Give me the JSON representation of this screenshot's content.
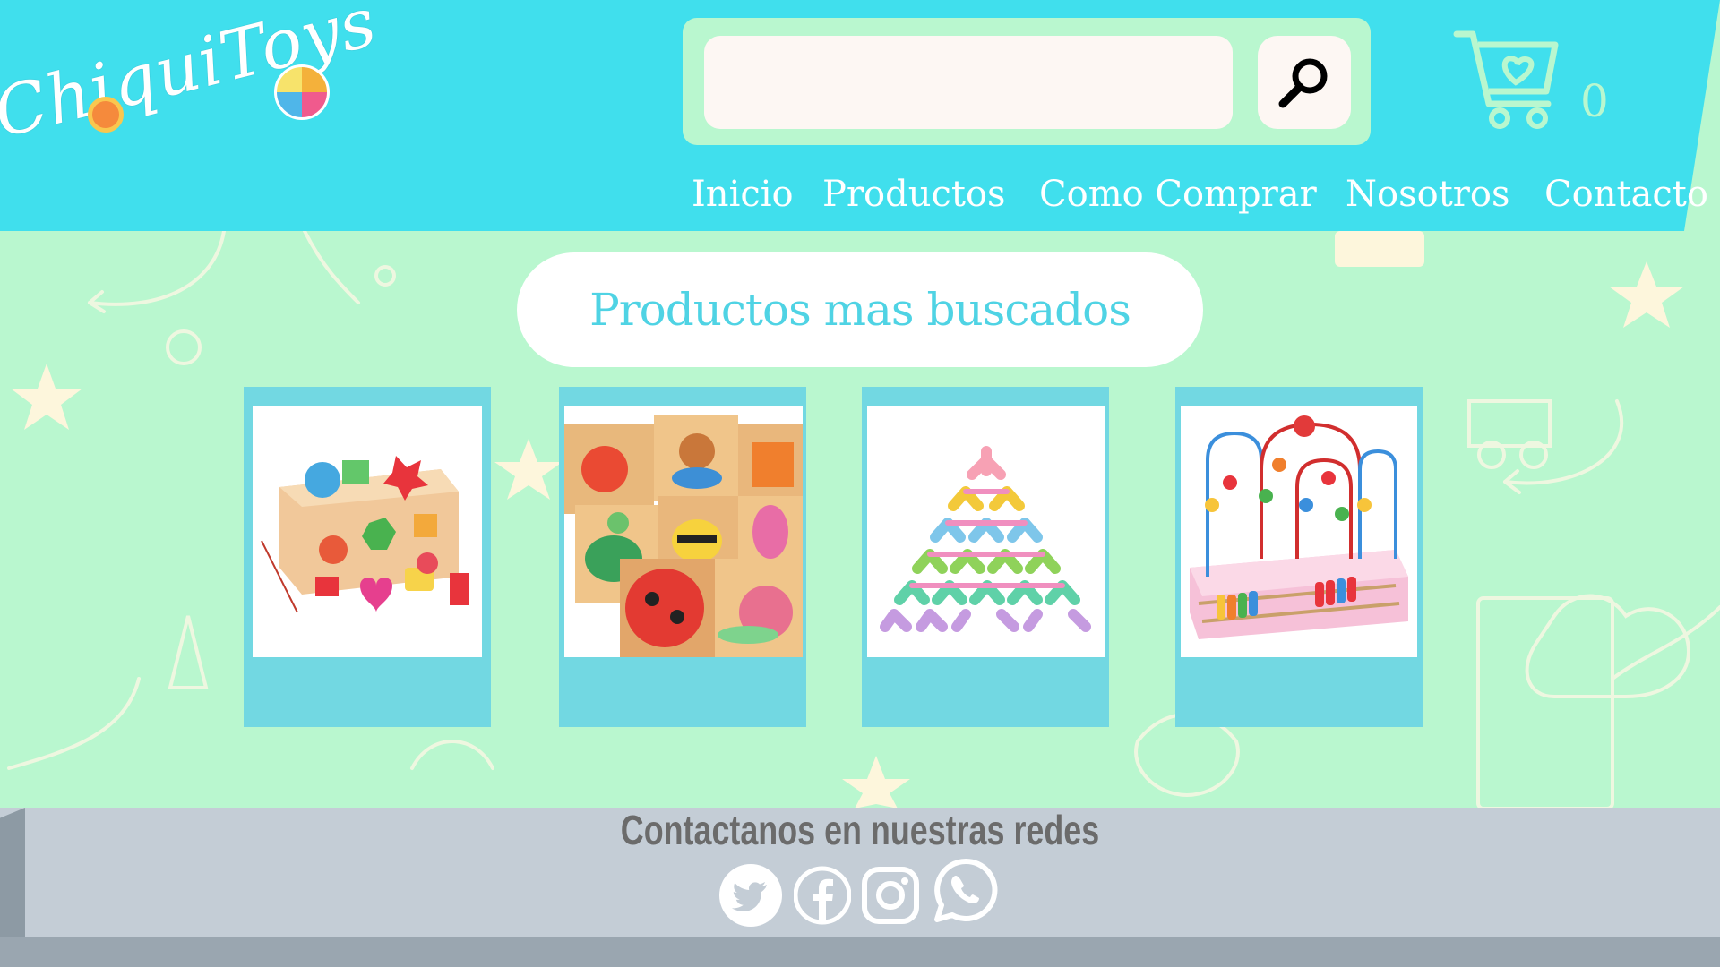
{
  "brand": {
    "name": "ChiquiToys"
  },
  "search": {
    "value": "",
    "placeholder": ""
  },
  "cart": {
    "count": "0"
  },
  "nav": {
    "items": [
      "Inicio",
      "Productos",
      "Como Comprar",
      "Nosotros",
      "Contacto"
    ]
  },
  "section": {
    "title": "Productos mas buscados"
  },
  "products": [
    {
      "image": "wooden shape sorter toy"
    },
    {
      "image": "wooden animal puzzles"
    },
    {
      "image": "stacking acrobat figures"
    },
    {
      "image": "bead maze abacus"
    }
  ],
  "footer": {
    "title": "Contactanos en nuestras redes",
    "social": [
      "twitter-icon",
      "facebook-icon",
      "instagram-icon",
      "whatsapp-icon"
    ]
  },
  "colors": {
    "header": "#40dfed",
    "background": "#b9f7cf",
    "card": "#72d8e2",
    "title": "#4fd3e4",
    "footer": "#c4cdd6"
  }
}
